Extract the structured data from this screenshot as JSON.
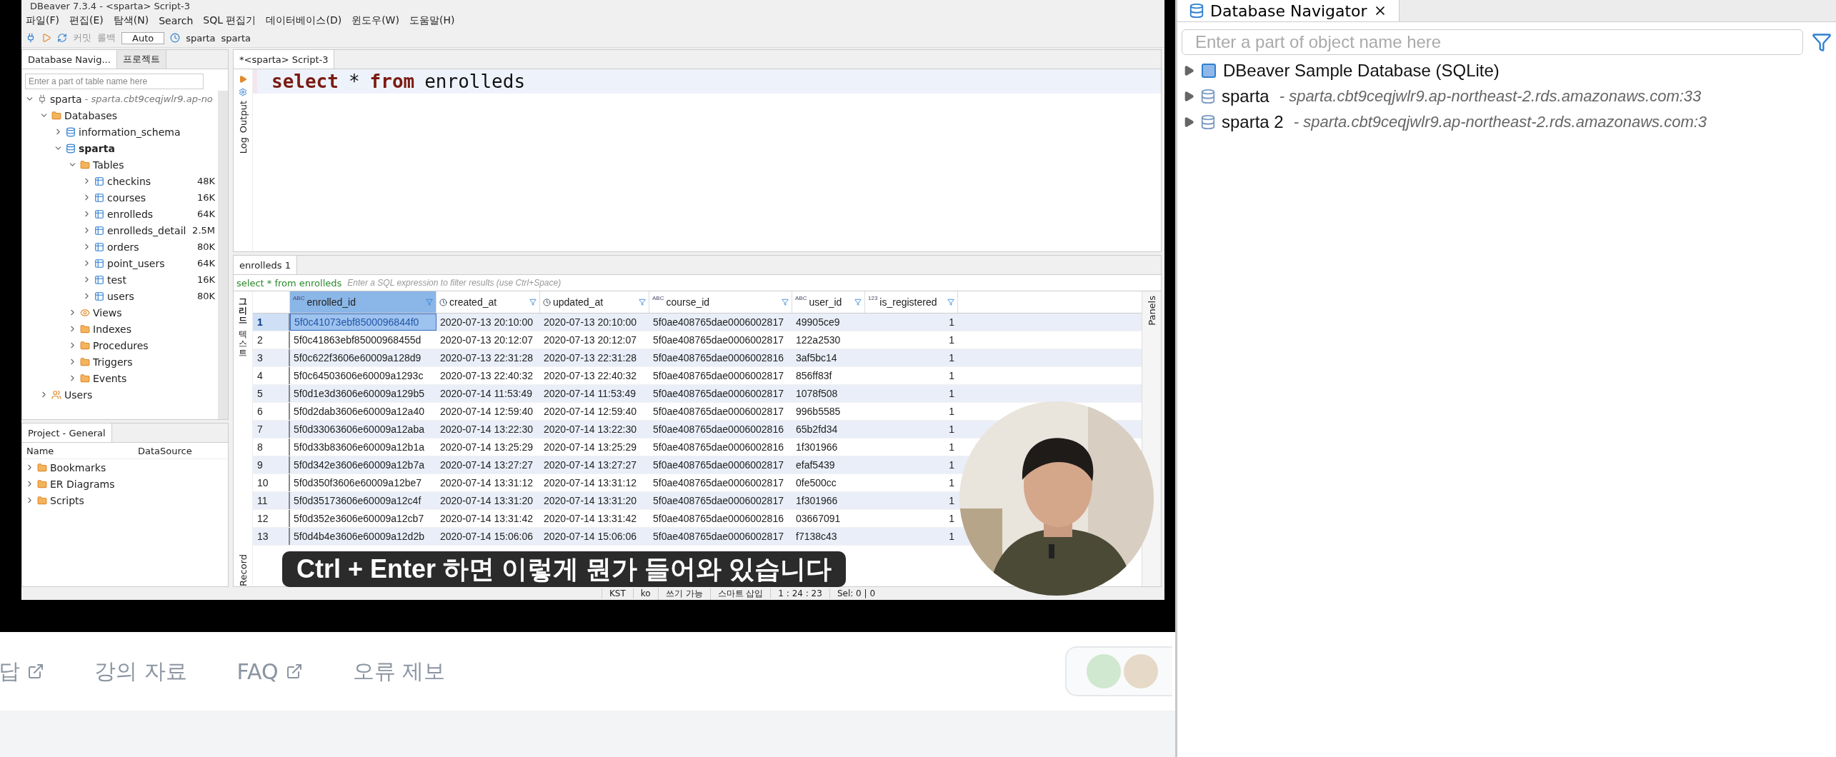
{
  "video": {
    "window": {
      "title": "DBeaver 7.3.4 - <sparta> Script-3"
    },
    "menu": [
      "파일(F)",
      "편집(E)",
      "탐색(N)",
      "Search",
      "SQL 편집기",
      "데이터베이스(D)",
      "윈도우(W)",
      "도움말(H)"
    ],
    "toolbar": {
      "commit": "커밋",
      "rollback": "롤백",
      "mode": "Auto",
      "connection": "sparta",
      "schema": "sparta"
    },
    "navigator": {
      "tabs": [
        {
          "label": "Database Navig...",
          "selected": true
        },
        {
          "label": "프로젝트",
          "selected": false
        }
      ],
      "search": {
        "placeholder": "Enter a part of table name here"
      },
      "tree": [
        {
          "label": "sparta",
          "kind": "connection",
          "detail": "- sparta.cbt9ceqjwlr9.ap-no",
          "expanded": true,
          "children": [
            {
              "label": "Databases",
              "kind": "folder",
              "expanded": true,
              "children": [
                {
                  "label": "information_schema",
                  "kind": "database",
                  "active": false,
                  "expanded": false
                },
                {
                  "label": "sparta",
                  "kind": "database",
                  "active": true,
                  "expanded": true,
                  "children": [
                    {
                      "label": "Tables",
                      "kind": "folder",
                      "expanded": true,
                      "children": [
                        {
                          "label": "checkins",
                          "kind": "table",
                          "size": "48K",
                          "expanded": false
                        },
                        {
                          "label": "courses",
                          "kind": "table",
                          "size": "16K",
                          "expanded": false
                        },
                        {
                          "label": "enrolleds",
                          "kind": "table",
                          "size": "64K",
                          "expanded": false
                        },
                        {
                          "label": "enrolleds_detail",
                          "kind": "table",
                          "size": "2.5M",
                          "expanded": false
                        },
                        {
                          "label": "orders",
                          "kind": "table",
                          "size": "80K",
                          "expanded": false
                        },
                        {
                          "label": "point_users",
                          "kind": "table",
                          "size": "64K",
                          "expanded": false
                        },
                        {
                          "label": "test",
                          "kind": "table",
                          "size": "16K",
                          "expanded": false
                        },
                        {
                          "label": "users",
                          "kind": "table",
                          "size": "80K",
                          "expanded": false
                        }
                      ]
                    },
                    {
                      "label": "Views",
                      "kind": "views",
                      "expanded": false
                    },
                    {
                      "label": "Indexes",
                      "kind": "folder",
                      "expanded": false
                    },
                    {
                      "label": "Procedures",
                      "kind": "folder",
                      "expanded": false
                    },
                    {
                      "label": "Triggers",
                      "kind": "folder",
                      "expanded": false
                    },
                    {
                      "label": "Events",
                      "kind": "folder",
                      "expanded": false
                    }
                  ]
                }
              ]
            },
            {
              "label": "Users",
              "kind": "users",
              "expanded": false
            }
          ]
        }
      ]
    },
    "project": {
      "title": "Project - General",
      "columns": [
        "Name",
        "DataSource"
      ],
      "items": [
        "Bookmarks",
        "ER Diagrams",
        "Scripts"
      ]
    },
    "editor": {
      "tab": "*<sparta> Script-3",
      "side": [
        "Output",
        "Log"
      ],
      "code": [
        {
          "kind": "keyword",
          "text": "select"
        },
        {
          "kind": "plain",
          "text": "*"
        },
        {
          "kind": "keyword",
          "text": "from"
        },
        {
          "kind": "plain",
          "text": "enrolleds"
        }
      ]
    },
    "results": {
      "tab": "enrolleds 1",
      "query": "select * from enrolleds",
      "filter": {
        "placeholder": "Enter a SQL expression to filter results (use Ctrl+Space)"
      },
      "side_tabs": [
        {
          "label": "그리드",
          "kind": "korean",
          "selected": true
        },
        {
          "label": "텍스트",
          "kind": "korean",
          "selected": false
        },
        {
          "label": "Record",
          "kind": "latin",
          "selected": false
        }
      ],
      "panels": "Panels",
      "columns": [
        {
          "name": "enrolled_id",
          "kind": "text",
          "badge": "ABC",
          "selected": true
        },
        {
          "name": "created_at",
          "kind": "datetime",
          "selected": false
        },
        {
          "name": "updated_at",
          "kind": "datetime",
          "selected": false
        },
        {
          "name": "course_id",
          "kind": "text",
          "badge": "ABC",
          "selected": false
        },
        {
          "name": "user_id",
          "kind": "text",
          "badge": "ABC",
          "selected": false
        },
        {
          "name": "is_registered",
          "kind": "number",
          "badge": "123",
          "selected": false
        }
      ],
      "rows": [
        {
          "num": "1",
          "selected": true,
          "cells": [
            "5f0c41073ebf8500096844f0",
            "2020-07-13 20:10:00",
            "2020-07-13 20:10:00",
            "5f0ae408765dae0006002817",
            "49905ce9",
            "1"
          ]
        },
        {
          "num": "2",
          "selected": false,
          "cells": [
            "5f0c41863ebf85000968455d",
            "2020-07-13 20:12:07",
            "2020-07-13 20:12:07",
            "5f0ae408765dae0006002817",
            "122a2530",
            "1"
          ]
        },
        {
          "num": "3",
          "selected": false,
          "cells": [
            "5f0c622f3606e60009a128d9",
            "2020-07-13 22:31:28",
            "2020-07-13 22:31:28",
            "5f0ae408765dae0006002816",
            "3af5bc14",
            "1"
          ]
        },
        {
          "num": "4",
          "selected": false,
          "cells": [
            "5f0c64503606e60009a1293c",
            "2020-07-13 22:40:32",
            "2020-07-13 22:40:32",
            "5f0ae408765dae0006002817",
            "856ff83f",
            "1"
          ]
        },
        {
          "num": "5",
          "selected": false,
          "cells": [
            "5f0d1e3d3606e60009a129b5",
            "2020-07-14 11:53:49",
            "2020-07-14 11:53:49",
            "5f0ae408765dae0006002817",
            "1078f508",
            "1"
          ]
        },
        {
          "num": "6",
          "selected": false,
          "cells": [
            "5f0d2dab3606e60009a12a40",
            "2020-07-14 12:59:40",
            "2020-07-14 12:59:40",
            "5f0ae408765dae0006002817",
            "996b5585",
            "1"
          ]
        },
        {
          "num": "7",
          "selected": false,
          "cells": [
            "5f0d33063606e60009a12aba",
            "2020-07-14 13:22:30",
            "2020-07-14 13:22:30",
            "5f0ae408765dae0006002816",
            "65b2fd34",
            "1"
          ]
        },
        {
          "num": "8",
          "selected": false,
          "cells": [
            "5f0d33b83606e60009a12b1a",
            "2020-07-14 13:25:29",
            "2020-07-14 13:25:29",
            "5f0ae408765dae0006002816",
            "1f301966",
            "1"
          ]
        },
        {
          "num": "9",
          "selected": false,
          "cells": [
            "5f0d342e3606e60009a12b7a",
            "2020-07-14 13:27:27",
            "2020-07-14 13:27:27",
            "5f0ae408765dae0006002817",
            "efaf5439",
            "1"
          ]
        },
        {
          "num": "10",
          "selected": false,
          "cells": [
            "5f0d350f3606e60009a12be7",
            "2020-07-14 13:31:12",
            "2020-07-14 13:31:12",
            "5f0ae408765dae0006002817",
            "0fe500cc",
            "1"
          ]
        },
        {
          "num": "11",
          "selected": false,
          "cells": [
            "5f0d35173606e60009a12c4f",
            "2020-07-14 13:31:20",
            "2020-07-14 13:31:20",
            "5f0ae408765dae0006002817",
            "1f301966",
            "1"
          ]
        },
        {
          "num": "12",
          "selected": false,
          "cells": [
            "5f0d352e3606e60009a12cb7",
            "2020-07-14 13:31:42",
            "2020-07-14 13:31:42",
            "5f0ae408765dae0006002816",
            "03667091",
            "1"
          ]
        },
        {
          "num": "13",
          "selected": false,
          "cells": [
            "5f0d4b4e3606e60009a12d2b",
            "2020-07-14 15:06:06",
            "2020-07-14 15:06:06",
            "5f0ae408765dae0006002817",
            "f7138c43",
            "1"
          ]
        }
      ]
    },
    "status_bar": [
      "KST",
      "ko",
      "쓰기 가능",
      "스마트 삽입",
      "1 : 24 : 23",
      "Sel: 0 | 0"
    ],
    "subtitle": "Ctrl + Enter 하면 이렇게 뭔가 들어와 있습니다"
  },
  "page_links": [
    {
      "label": "답",
      "external": true
    },
    {
      "label": "강의 자료",
      "external": false
    },
    {
      "label": "FAQ",
      "external": true
    },
    {
      "label": "오류 제보",
      "external": false
    }
  ],
  "db_navigator": {
    "tab": "Database Navigator",
    "search": {
      "placeholder": "Enter a part of object name here"
    },
    "items": [
      {
        "label": "DBeaver Sample Database (SQLite)",
        "kind": "sqlite"
      },
      {
        "label": "sparta",
        "kind": "mysql",
        "detail": "- sparta.cbt9ceqjwlr9.ap-northeast-2.rds.amazonaws.com:33"
      },
      {
        "label": "sparta 2",
        "kind": "mysql",
        "detail": "- sparta.cbt9ceqjwlr9.ap-northeast-2.rds.amazonaws.com:3"
      }
    ]
  }
}
